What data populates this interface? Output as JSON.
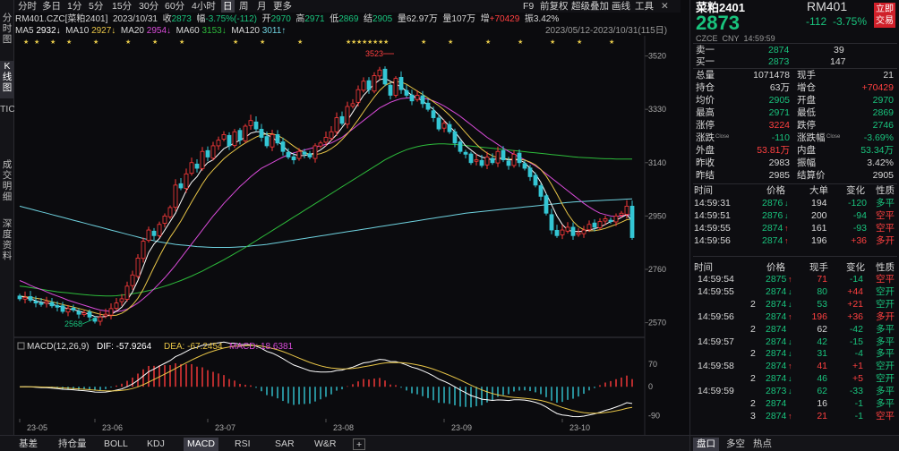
{
  "leftnav": [
    "分时图",
    "K线图",
    "TICK",
    "成交明细",
    "深度资料"
  ],
  "toolbar": {
    "periods": [
      "分时",
      "多日",
      "1分",
      "5分",
      "15分",
      "30分",
      "60分",
      "4小时",
      "日",
      "周",
      "月",
      "更多"
    ],
    "active": "日",
    "right_items": [
      "F9",
      "前复权",
      "超级叠加",
      "画线",
      "工具"
    ],
    "close_icon": "close-icon"
  },
  "info_row": {
    "symbol": "RM401.CZC[菜粕2401]",
    "date": "2023/10/31",
    "收_label": "收",
    "收": "2873",
    "幅_label": "幅",
    "幅": "-3.75%(-112)",
    "开_label": "开",
    "开": "2970",
    "高_label": "高",
    "高": "2971",
    "低_label": "低",
    "低": "2869",
    "结_label": "结",
    "结": "2905",
    "量_label": "量",
    "量": "62.97万",
    "仓_label": "量",
    "仓": "107万",
    "增_label": "增",
    "增": "+70429",
    "振_label": "振",
    "振": "3.42%"
  },
  "ma_row": {
    "ma5": "MA5",
    "ma5_val": "2932↓",
    "ma10": "MA10",
    "ma10_val": "2927↓",
    "ma20": "MA20",
    "ma20_val": "2954↓",
    "ma60": "MA60",
    "ma60_val": "3153↓",
    "ma120": "MA120",
    "ma120_val": "3011↑",
    "range": "2023/05/12-2023/10/31(115日)"
  },
  "macd_row": {
    "label": "MACD(12,26,9)",
    "dif": "DIF: -57.9264",
    "dea": "DEA: -67.2454",
    "macd": "MACD: 18.6381"
  },
  "chart_data": {
    "type": "candlestick",
    "y_ticks": [
      "3520",
      "3330",
      "3140",
      "2950",
      "2760",
      "2570"
    ],
    "x_ticks": [
      "23-05",
      "23-06",
      "23-07",
      "23-08",
      "23-09",
      "23-10"
    ],
    "annotations": {
      "high": "3523",
      "low": "2568"
    },
    "macd_ticks": [
      "70",
      "0",
      "-90"
    ],
    "ylim": [
      2540,
      3560
    ],
    "macd_ylim": [
      -100,
      90
    ],
    "series": [
      {
        "name": "MA5",
        "color": "#ffffff"
      },
      {
        "name": "MA10",
        "color": "#e8c547"
      },
      {
        "name": "MA20",
        "color": "#d84bd8"
      },
      {
        "name": "MA60",
        "color": "#2dbb3b"
      },
      {
        "name": "MA120",
        "color": "#6fd3e0"
      }
    ],
    "candles_note": "",
    "closes": [
      2655,
      2660,
      2650,
      2640,
      2635,
      2645,
      2630,
      2625,
      2610,
      2620,
      2615,
      2600,
      2605,
      2590,
      2575,
      2590,
      2600,
      2620,
      2640,
      2655,
      2700,
      2740,
      2800,
      2860,
      2900,
      2880,
      2920,
      2950,
      2980,
      3060,
      3050,
      3100,
      3140,
      3120,
      3180,
      3160,
      3200,
      3220,
      3240,
      3200,
      3250,
      3220,
      3270,
      3290,
      3260,
      3230,
      3200,
      3240,
      3210,
      3180,
      3160,
      3150,
      3180,
      3170,
      3160,
      3200,
      3210,
      3230,
      3250,
      3300,
      3280,
      3340,
      3350,
      3400,
      3430,
      3400,
      3450,
      3470,
      3420,
      3380,
      3440,
      3400,
      3380,
      3360,
      3380,
      3350,
      3330,
      3300,
      3260,
      3280,
      3250,
      3210,
      3180,
      3170,
      3140,
      3150,
      3130,
      3160,
      3140,
      3180,
      3150,
      3130,
      3170,
      3140,
      3120,
      3090,
      3060,
      3020,
      2960,
      2900,
      2880,
      2900,
      2910,
      2880,
      2890,
      2900,
      2920,
      2910,
      2930,
      2940,
      2930,
      2950,
      2960,
      2985,
      2873
    ],
    "ma5": [
      2665,
      2660,
      2655,
      2648,
      2643,
      2640,
      2636,
      2630,
      2625,
      2620,
      2616,
      2612,
      2605,
      2600,
      2592,
      2590,
      2592,
      2600,
      2610,
      2625,
      2650,
      2680,
      2720,
      2770,
      2820,
      2850,
      2870,
      2900,
      2930,
      2960,
      3000,
      3040,
      3070,
      3090,
      3120,
      3140,
      3150,
      3170,
      3190,
      3200,
      3210,
      3220,
      3230,
      3245,
      3250,
      3250,
      3240,
      3230,
      3215,
      3200,
      3180,
      3170,
      3165,
      3165,
      3170,
      3175,
      3185,
      3200,
      3220,
      3240,
      3265,
      3290,
      3320,
      3350,
      3380,
      3400,
      3420,
      3435,
      3440,
      3430,
      3420,
      3410,
      3395,
      3380,
      3370,
      3360,
      3345,
      3330,
      3310,
      3290,
      3270,
      3250,
      3225,
      3200,
      3185,
      3170,
      3160,
      3155,
      3150,
      3155,
      3155,
      3150,
      3150,
      3150,
      3140,
      3120,
      3100,
      3070,
      3030,
      2990,
      2950,
      2920,
      2900,
      2895,
      2895,
      2895,
      2900,
      2905,
      2910,
      2920,
      2930,
      2935,
      2945,
      2955,
      2932
    ],
    "ma20": [
      2720,
      2712,
      2703,
      2695,
      2688,
      2680,
      2672,
      2665,
      2658,
      2650,
      2644,
      2638,
      2632,
      2626,
      2620,
      2615,
      2612,
      2610,
      2610,
      2612,
      2618,
      2628,
      2640,
      2655,
      2672,
      2690,
      2710,
      2730,
      2752,
      2775,
      2800,
      2825,
      2850,
      2875,
      2900,
      2925,
      2950,
      2972,
      2995,
      3015,
      3035,
      3055,
      3072,
      3090,
      3105,
      3120,
      3130,
      3140,
      3150,
      3160,
      3168,
      3175,
      3180,
      3185,
      3190,
      3195,
      3200,
      3205,
      3210,
      3220,
      3230,
      3245,
      3260,
      3275,
      3290,
      3305,
      3320,
      3335,
      3345,
      3355,
      3362,
      3368,
      3370,
      3372,
      3372,
      3370,
      3366,
      3360,
      3352,
      3342,
      3330,
      3318,
      3305,
      3290,
      3275,
      3260,
      3245,
      3230,
      3218,
      3205,
      3192,
      3180,
      3170,
      3160,
      3150,
      3140,
      3128,
      3115,
      3100,
      3085,
      3070,
      3055,
      3040,
      3025,
      3010,
      2995,
      2982,
      2970,
      2960,
      2955,
      2950,
      2948,
      2950,
      2954,
      2954
    ],
    "ma60": [
      2700,
      2698,
      2695,
      2692,
      2689,
      2686,
      2683,
      2680,
      2678,
      2676,
      2674,
      2672,
      2670,
      2668,
      2667,
      2666,
      2665,
      2665,
      2666,
      2668,
      2670,
      2673,
      2676,
      2680,
      2684,
      2689,
      2694,
      2700,
      2706,
      2713,
      2720,
      2728,
      2736,
      2745,
      2754,
      2764,
      2774,
      2784,
      2794,
      2805,
      2816,
      2827,
      2838,
      2850,
      2862,
      2874,
      2886,
      2898,
      2910,
      2922,
      2934,
      2946,
      2958,
      2970,
      2982,
      2994,
      3006,
      3018,
      3030,
      3042,
      3054,
      3066,
      3078,
      3090,
      3102,
      3114,
      3126,
      3138,
      3150,
      3160,
      3170,
      3178,
      3186,
      3192,
      3197,
      3201,
      3204,
      3206,
      3207,
      3207,
      3206,
      3205,
      3203,
      3201,
      3199,
      3197,
      3195,
      3193,
      3191,
      3189,
      3187,
      3185,
      3183,
      3181,
      3179,
      3177,
      3175,
      3173,
      3171,
      3169,
      3167,
      3165,
      3163,
      3161,
      3159,
      3158,
      3157,
      3156,
      3155,
      3154,
      3154,
      3153,
      3153,
      3153,
      3153
    ],
    "ma120": [
      2985,
      2980,
      2975,
      2970,
      2965,
      2960,
      2955,
      2950,
      2945,
      2940,
      2935,
      2930,
      2925,
      2920,
      2915,
      2910,
      2905,
      2900,
      2895,
      2890,
      2885,
      2880,
      2875,
      2870,
      2866,
      2862,
      2858,
      2855,
      2852,
      2849,
      2847,
      2845,
      2843,
      2841,
      2840,
      2839,
      2838,
      2838,
      2838,
      2838,
      2839,
      2840,
      2841,
      2843,
      2845,
      2847,
      2849,
      2852,
      2855,
      2858,
      2861,
      2864,
      2867,
      2870,
      2873,
      2876,
      2879,
      2882,
      2885,
      2888,
      2891,
      2894,
      2897,
      2900,
      2903,
      2906,
      2909,
      2912,
      2915,
      2918,
      2921,
      2924,
      2927,
      2930,
      2933,
      2936,
      2939,
      2942,
      2945,
      2948,
      2951,
      2954,
      2957,
      2960,
      2962,
      2964,
      2966,
      2968,
      2970,
      2972,
      2974,
      2976,
      2978,
      2980,
      2982,
      2984,
      2986,
      2988,
      2990,
      2992,
      2994,
      2996,
      2998,
      3000,
      3001,
      3002,
      3003,
      3004,
      3005,
      3006,
      3007,
      3008,
      3009,
      3010,
      3011
    ]
  },
  "right": {
    "name": "菜粕2401",
    "code": "RM401",
    "trade_btn": "立即交易",
    "price": "2873",
    "change": "-112",
    "pct": "-3.75%",
    "exchange": "CZCE",
    "currency": "CNY",
    "time": "14:59:59",
    "sell1_label": "卖一",
    "sell1_price": "2874",
    "sell1_vol": "39",
    "buy1_label": "买一",
    "buy1_price": "2873",
    "buy1_vol": "147",
    "stats": [
      {
        "l1": "总量",
        "v1": "1071478",
        "l2": "现手",
        "v2": "21",
        "c1": "w",
        "c2": "w"
      },
      {
        "l1": "持仓",
        "v1": "63万",
        "l2": "增仓",
        "v2": "+70429",
        "c1": "w",
        "c2": "r"
      },
      {
        "l1": "均价",
        "v1": "2905",
        "l2": "开盘",
        "v2": "2970",
        "c1": "g",
        "c2": "g"
      },
      {
        "l1": "最高",
        "v1": "2971",
        "l2": "最低",
        "v2": "2869",
        "c1": "g",
        "c2": "g"
      },
      {
        "l1": "涨停",
        "v1": "3224",
        "l2": "跌停",
        "v2": "2746",
        "c1": "r",
        "c2": "g"
      },
      {
        "l1": "涨跌",
        "l1s": "Close",
        "v1": "-110",
        "l2": "涨跌幅",
        "l2s": "Close",
        "v2": "-3.69%",
        "c1": "g",
        "c2": "g"
      },
      {
        "l1": "外盘",
        "v1": "53.81万",
        "l2": "内盘",
        "v2": "53.34万",
        "c1": "r",
        "c2": "g"
      },
      {
        "l1": "昨收",
        "v1": "2983",
        "l2": "振幅",
        "v2": "3.42%",
        "c1": "w",
        "c2": "w"
      },
      {
        "l1": "昨结",
        "v1": "2985",
        "l2": "结算价",
        "v2": "2905",
        "c1": "w",
        "c2": "w"
      }
    ],
    "table1_headers": [
      "时间",
      "价格",
      "大单",
      "变化",
      "性质"
    ],
    "table1": [
      {
        "t": "14:59:31",
        "p": "2876",
        "a": "↓",
        "q": "194",
        "c": "-120",
        "n": "多平",
        "pc": "g",
        "cc": "g",
        "nc": "g"
      },
      {
        "t": "14:59:51",
        "p": "2876",
        "a": "↓",
        "q": "200",
        "c": "-94",
        "n": "空平",
        "pc": "g",
        "cc": "g",
        "nc": "r"
      },
      {
        "t": "14:59:55",
        "p": "2874",
        "a": "↑",
        "q": "161",
        "c": "-93",
        "n": "空平",
        "pc": "g",
        "cc": "g",
        "nc": "r"
      },
      {
        "t": "14:59:56",
        "p": "2874",
        "a": "↑",
        "q": "196",
        "c": "+36",
        "n": "多开",
        "pc": "g",
        "cc": "r",
        "nc": "r"
      }
    ],
    "table2_headers": [
      "时间",
      "价格",
      "现手",
      "变化",
      "性质"
    ],
    "table2": [
      {
        "t": "14:59:54",
        "p": "2875",
        "a": "↑",
        "q": "71",
        "c": "-14",
        "n": "空平",
        "ac": "r",
        "qc": "r",
        "cc": "g",
        "nc": "r"
      },
      {
        "t": "14:59:55",
        "p": "2874",
        "a": "↓",
        "q": "80",
        "c": "+44",
        "n": "空开",
        "ac": "g",
        "qc": "g",
        "cc": "r",
        "nc": "g"
      },
      {
        "t": "2",
        "p": "2874",
        "a": "↓",
        "q": "53",
        "c": "+21",
        "n": "空开",
        "ac": "g",
        "qc": "g",
        "cc": "r",
        "nc": "g"
      },
      {
        "t": "14:59:56",
        "p": "2874",
        "a": "↑",
        "q": "196",
        "c": "+36",
        "n": "多开",
        "ac": "r",
        "qc": "r",
        "cc": "r",
        "nc": "r"
      },
      {
        "t": "2",
        "p": "2874",
        "a": "",
        "q": "62",
        "c": "-42",
        "n": "多平",
        "ac": "g",
        "qc": "w",
        "cc": "g",
        "nc": "g"
      },
      {
        "t": "14:59:57",
        "p": "2874",
        "a": "↓",
        "q": "42",
        "c": "-15",
        "n": "多平",
        "ac": "g",
        "qc": "g",
        "cc": "g",
        "nc": "g"
      },
      {
        "t": "2",
        "p": "2874",
        "a": "↓",
        "q": "31",
        "c": "-4",
        "n": "多平",
        "ac": "g",
        "qc": "g",
        "cc": "g",
        "nc": "g"
      },
      {
        "t": "14:59:58",
        "p": "2874",
        "a": "↑",
        "q": "41",
        "c": "+1",
        "n": "空开",
        "ac": "r",
        "qc": "r",
        "cc": "r",
        "nc": "g"
      },
      {
        "t": "2",
        "p": "2874",
        "a": "↓",
        "q": "46",
        "c": "+5",
        "n": "空开",
        "ac": "g",
        "qc": "g",
        "cc": "r",
        "nc": "g"
      },
      {
        "t": "14:59:59",
        "p": "2873",
        "a": "↓",
        "q": "62",
        "c": "-33",
        "n": "多平",
        "ac": "g",
        "qc": "g",
        "cc": "g",
        "nc": "g"
      },
      {
        "t": "2",
        "p": "2874",
        "a": "",
        "q": "16",
        "c": "-1",
        "n": "多平",
        "ac": "w",
        "qc": "w",
        "cc": "g",
        "nc": "g"
      },
      {
        "t": "3",
        "p": "2874",
        "a": "↑",
        "q": "21",
        "c": "-1",
        "n": "空平",
        "ac": "r",
        "qc": "r",
        "cc": "g",
        "nc": "r"
      }
    ],
    "tabs": [
      "盘口",
      "多空",
      "热点"
    ],
    "active_tab": "盘口"
  },
  "bottom_tabs": [
    "基差",
    "持仓量",
    "BOLL",
    "KDJ",
    "MACD",
    "RSI",
    "SAR",
    "W&R"
  ],
  "bottom_active": "MACD",
  "add_icon": "add-indicator-icon",
  "colors": {
    "up": "#ff4040",
    "down": "#19c37d",
    "bg": "#0b0b0e",
    "candle_up": "#ff3b3b",
    "candle_down": "#34c6d4"
  }
}
